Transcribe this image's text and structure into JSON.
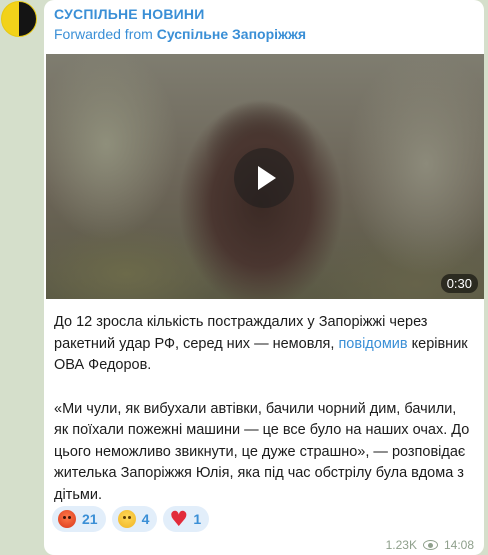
{
  "channel": {
    "name": "СУСПІЛЬНЕ НОВИНИ",
    "avatar_colors": [
      "#f2d21a",
      "#141414"
    ]
  },
  "forward": {
    "prefix": "Forwarded from",
    "source": "Суспільне Запоріжжя"
  },
  "video": {
    "duration": "0:30",
    "play_icon": "play-icon"
  },
  "message": {
    "p1_before_link": "До 12 зросла кількість постраждалих у Запоріжжі через ракетний удар РФ, серед них — немовля, ",
    "p1_link": "повідомив",
    "p1_after_link": " керівник ОВА Федоров.",
    "p2": "«Ми чули, як вибухали автівки, бачили чорний дим, бачили, як поїхали пожежні машини — це все було на наших очах. До цього неможливо звикнути, це дуже страшно», — розповідає жителька Запоріжжя Юлія, яка під час обстрілу була вдома з дітьми."
  },
  "reactions": [
    {
      "emoji": "angry-face-icon",
      "count": "21"
    },
    {
      "emoji": "crying-face-icon",
      "count": "4"
    },
    {
      "emoji": "red-heart-icon",
      "count": "1"
    }
  ],
  "meta": {
    "views": "1.23K",
    "time": "14:08"
  },
  "colors": {
    "accent": "#3a8fd6",
    "background": "#d5dfcb",
    "reaction_bg": "#e2eefa"
  }
}
